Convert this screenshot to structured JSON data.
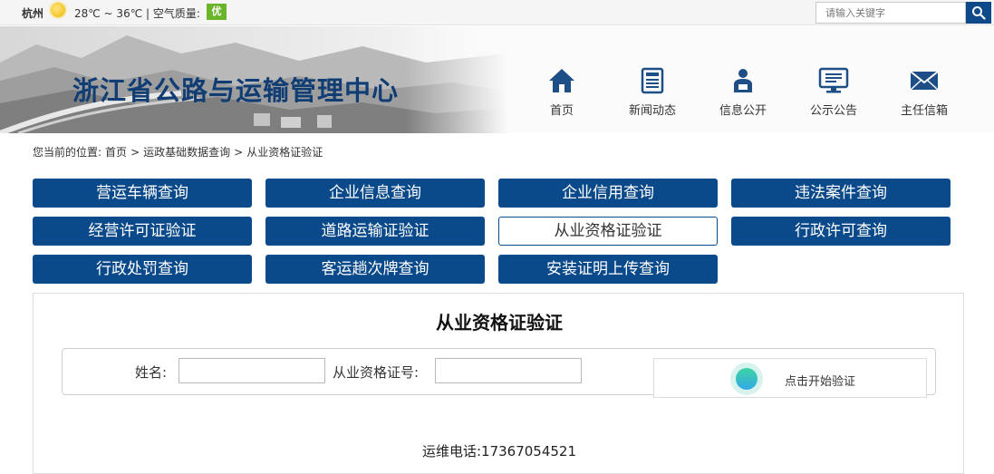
{
  "topbar": {
    "city": "杭州",
    "temperature": "28℃ ~ 36℃",
    "separator": "|",
    "air_quality_label": "空气质量:",
    "air_quality_value": "优",
    "search_placeholder": "请输入关键字"
  },
  "header": {
    "site_title": "浙江省公路与运输管理中心",
    "nav": [
      {
        "label": "首页",
        "icon": "home-icon"
      },
      {
        "label": "新闻动态",
        "icon": "news-icon"
      },
      {
        "label": "信息公开",
        "icon": "person-info-icon"
      },
      {
        "label": "公示公告",
        "icon": "monitor-icon"
      },
      {
        "label": "主任信箱",
        "icon": "mail-icon"
      }
    ]
  },
  "breadcrumb": {
    "prefix": "您当前的位置:",
    "items": [
      "首页",
      "运政基础数据查询",
      "从业资格证验证"
    ],
    "sep": ">"
  },
  "queries": [
    {
      "label": "营运车辆查询",
      "active": false
    },
    {
      "label": "企业信息查询",
      "active": false
    },
    {
      "label": "企业信用查询",
      "active": false
    },
    {
      "label": "违法案件查询",
      "active": false
    },
    {
      "label": "经营许可证验证",
      "active": false
    },
    {
      "label": "道路运输证验证",
      "active": false
    },
    {
      "label": "从业资格证验证",
      "active": true
    },
    {
      "label": "行政许可查询",
      "active": false
    },
    {
      "label": "行政处罚查询",
      "active": false
    },
    {
      "label": "客运趟次牌查询",
      "active": false
    },
    {
      "label": "安装证明上传查询",
      "active": false
    }
  ],
  "panel": {
    "title": "从业资格证验证",
    "name_label": "姓名:",
    "name_value": "",
    "cert_label": "从业资格证号:",
    "cert_value": "",
    "captcha_text": "点击开始验证",
    "phone": "运维电话:17367054521"
  },
  "colors": {
    "brand_blue": "#0b4a8a",
    "title_blue": "#103d73",
    "aqi_green": "#6bb52b"
  }
}
